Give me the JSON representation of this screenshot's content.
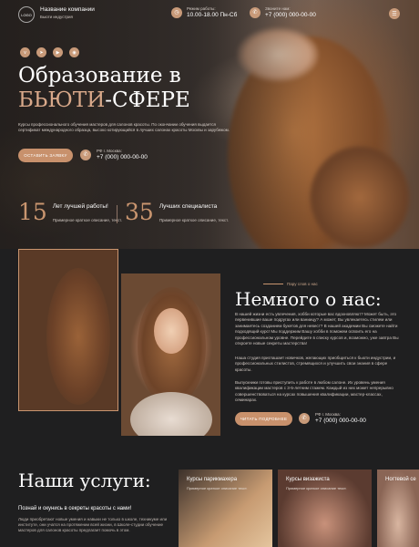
{
  "header": {
    "logo_text": "LOGO",
    "company_name": "Название компании",
    "company_subtitle": "Бьюти индустрия",
    "hours_label": "Режим работы:",
    "hours_value": "10.00-18.00 Пн-Сб",
    "contact_label": "Звоните нам:",
    "contact_value": "+7 (000) 000-00-00"
  },
  "hero": {
    "title_line1": "Образование в",
    "title_accent": "БЬЮТИ",
    "title_rest": "-СФЕРЕ",
    "description": "Курсы профессионального обучения мастеров для салонов красоты. По окончании обучения выдается сертификат международного образца, высоко котирующийся в лучших салонах красоты Москвы и зарубежом.",
    "cta_label": "ОСТАВИТЬ ЗАЯВКУ",
    "phone_city": "РФ г. Москва:",
    "phone_number": "+7 (000) 000-00-00",
    "stats": [
      {
        "number": "15",
        "title": "Лет лучшей работы!",
        "desc": "Примерное краткое описание, текст."
      },
      {
        "number": "35",
        "title": "Лучших специалиста",
        "desc": "Примерное краткое описание, текст."
      }
    ]
  },
  "about": {
    "kicker": "Пару слов о нас",
    "title": "Немного о нас:",
    "paragraph1": "В нашей жизни есть увлечения, хобби которые вас вдохновляют? Может быть, это первенившие ваше подругах или ваниицу? А может, Вы увлекаетесь стилем или занимаетесь созданием букетов для невест? В нашей академии Вы сможете найти подходящий курс! Мы поддержим Вашу хобби в поможем освоить его на профессиональном уровне. Перейдите в списку курсов и, возможно, уже завтра Вы откроете новые секреты мастерства!",
    "paragraph2": "Наша студия приглашает новичков, желающих приобщиться к бьюти индустрии, и профессиональных стилистов, стремящихся и улучшить свои знания в сфере красоты.",
    "paragraph3": "Выпускники готовы приступить к работе в любом салоне. Их уровень умения квалификации мастеров с 3-5-летним стажем. Каждый из них может непрерывно совершенствоваться на курсах повышения квалификации, мастер-классах, семинарах.",
    "cta_label": "ЧИТАТЬ ПОДРОБНЕЕ",
    "phone_city": "РФ г. Москва:",
    "phone_number": "+7 (000) 000-00-00"
  },
  "services": {
    "title": "Наши услуги:",
    "subtitle": "Познай и окунись в секреты красоты с нами!",
    "description": "Люди приобретают новые умения и навыки не только в школе, техникуме или институте, они учатся на протяжении всей жизни, в Школе-студии обучение мастеров для салонов красоты предлагает помочь в этом.",
    "cards": [
      {
        "title": "Курсы парикмахера",
        "desc": "Примерное краткое описание текст."
      },
      {
        "title": "Курсы визажиста",
        "desc": "Примерное краткое описание текст."
      },
      {
        "title": "Ногтевой се",
        "desc": ""
      }
    ]
  },
  "colors": {
    "accent": "#c9956f",
    "background": "#1f1f20",
    "button": "#c8916c"
  }
}
